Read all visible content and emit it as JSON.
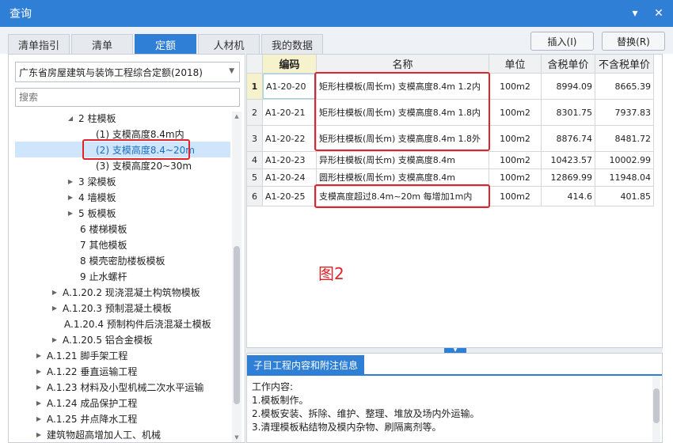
{
  "window": {
    "title": "查询",
    "minimize_glyph": "▾",
    "close_glyph": "✕"
  },
  "tabs": [
    "清单指引",
    "清单",
    "定额",
    "人材机",
    "我的数据"
  ],
  "actions": {
    "insert": "插入(I)",
    "replace": "替换(R)"
  },
  "left": {
    "quota_book": "广东省房屋建筑与装饰工程综合定额(2018)",
    "search_placeholder": "搜索",
    "tree": [
      {
        "label": "2 柱模板",
        "expander": "◢"
      },
      {
        "label": "(1) 支模高度8.4m内",
        "expander": ""
      },
      {
        "label": "(2) 支模高度8.4~20m",
        "expander": ""
      },
      {
        "label": "(3) 支模高度20~30m",
        "expander": ""
      },
      {
        "label": "3 梁模板",
        "expander": "▶"
      },
      {
        "label": "4 墙模板",
        "expander": "▶"
      },
      {
        "label": "5 板模板",
        "expander": "▶"
      },
      {
        "label": "6 楼梯模板",
        "expander": ""
      },
      {
        "label": "7 其他模板",
        "expander": ""
      },
      {
        "label": "8 模壳密肋楼板模板",
        "expander": ""
      },
      {
        "label": "9 止水螺杆",
        "expander": ""
      },
      {
        "label": "A.1.20.2 现浇混凝土构筑物模板",
        "expander": "▶"
      },
      {
        "label": "A.1.20.3 预制混凝土模板",
        "expander": "▶"
      },
      {
        "label": "A.1.20.4 预制构件后浇混凝土模板",
        "expander": ""
      },
      {
        "label": "A.1.20.5 铝合金模板",
        "expander": "▶"
      },
      {
        "label": "A.1.21 脚手架工程",
        "expander": "▶"
      },
      {
        "label": "A.1.22 垂直运输工程",
        "expander": "▶"
      },
      {
        "label": "A.1.23 材料及小型机械二次水平运输",
        "expander": "▶"
      },
      {
        "label": "A.1.24 成品保护工程",
        "expander": "▶"
      },
      {
        "label": "A.1.25 井点降水工程",
        "expander": "▶"
      },
      {
        "label": "建筑物超高增加人工、机械",
        "expander": "▶"
      }
    ]
  },
  "grid": {
    "headers": {
      "code": "编码",
      "name": "名称",
      "unit": "单位",
      "price_tax": "含税单价",
      "price_notax": "不含税单价"
    },
    "rows": [
      {
        "no": "1",
        "code": "A1-20-20",
        "name": "矩形柱模板(周长m) 支模高度8.4m 1.2内",
        "unit": "100m2",
        "price_tax": "8994.09",
        "price_notax": "8665.39"
      },
      {
        "no": "2",
        "code": "A1-20-21",
        "name": "矩形柱模板(周长m) 支模高度8.4m 1.8内",
        "unit": "100m2",
        "price_tax": "8301.75",
        "price_notax": "7937.83"
      },
      {
        "no": "3",
        "code": "A1-20-22",
        "name": "矩形柱模板(周长m) 支模高度8.4m 1.8外",
        "unit": "100m2",
        "price_tax": "8876.74",
        "price_notax": "8481.72"
      },
      {
        "no": "4",
        "code": "A1-20-23",
        "name": "异形柱模板(周长m) 支模高度8.4m",
        "unit": "100m2",
        "price_tax": "10423.57",
        "price_notax": "10002.99"
      },
      {
        "no": "5",
        "code": "A1-20-24",
        "name": "圆形柱模板(周长m) 支模高度8.4m",
        "unit": "100m2",
        "price_tax": "12869.99",
        "price_notax": "11948.04"
      },
      {
        "no": "6",
        "code": "A1-20-25",
        "name": "支模高度超过8.4m~20m 每增加1m内",
        "unit": "100m2",
        "price_tax": "414.6",
        "price_notax": "401.85"
      }
    ]
  },
  "annotation": {
    "figure_label": "图2",
    "color": "#e0242b"
  },
  "detail": {
    "tab_label": "子目工程内容和附注信息",
    "lines": [
      "工作内容:",
      "1.模板制作。",
      "2.模板安装、拆除、维护、整理、堆放及场内外运输。",
      "3.清理模板粘结物及模内杂物、刷隔离剂等。"
    ]
  },
  "colors": {
    "accent": "#2f7fd6",
    "selection": "#cfe5fb",
    "header_highlight": "#f6f2cc"
  }
}
